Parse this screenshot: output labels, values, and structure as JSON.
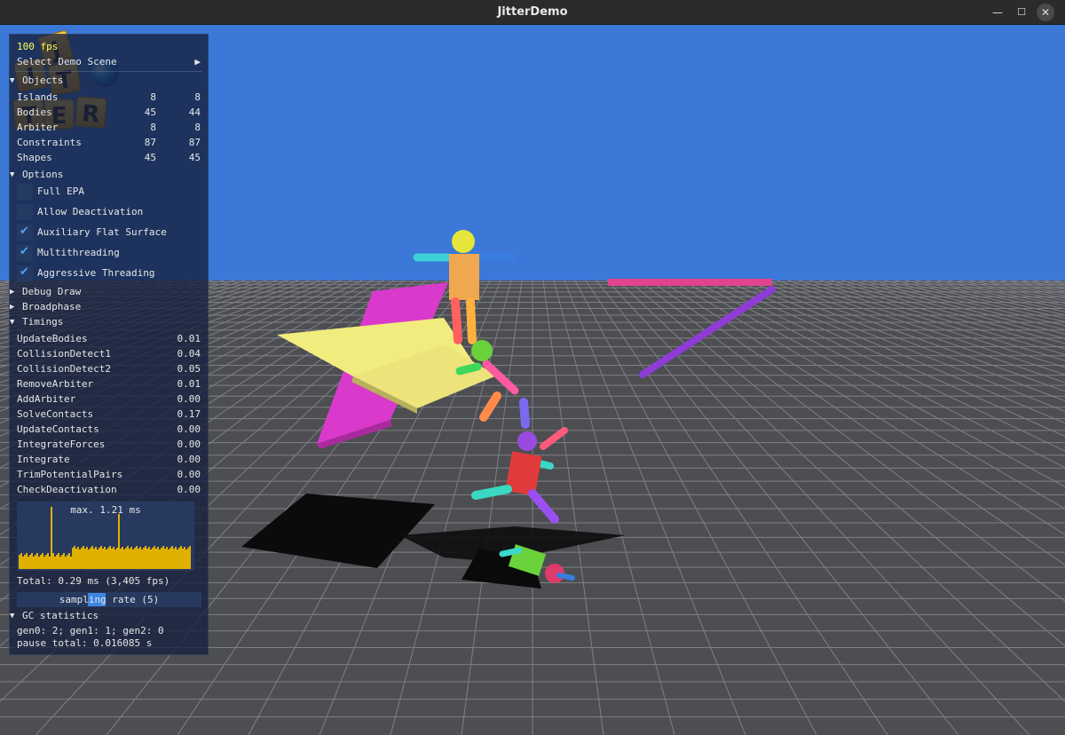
{
  "window": {
    "title": "JitterDemo",
    "minimize": "—",
    "maximize": "☐",
    "close": "✕"
  },
  "panel": {
    "fps": "100 fps",
    "select_scene": "Select Demo Scene",
    "select_arrow": "▶",
    "objects": {
      "header": "Objects",
      "rows": [
        {
          "label": "Islands",
          "a": "8",
          "b": "8"
        },
        {
          "label": "Bodies",
          "a": "45",
          "b": "44"
        },
        {
          "label": "Arbiter",
          "a": "8",
          "b": "8"
        },
        {
          "label": "Constraints",
          "a": "87",
          "b": "87"
        },
        {
          "label": "Shapes",
          "a": "45",
          "b": "45"
        }
      ]
    },
    "options": {
      "header": "Options",
      "items": [
        {
          "label": "Full EPA",
          "checked": false
        },
        {
          "label": "Allow Deactivation",
          "checked": false
        },
        {
          "label": "Auxiliary Flat Surface",
          "checked": true
        },
        {
          "label": "Multithreading",
          "checked": true
        },
        {
          "label": "Aggressive Threading",
          "checked": true
        }
      ]
    },
    "debug_draw": "Debug Draw",
    "broadphase": "Broadphase",
    "timings": {
      "header": "Timings",
      "rows": [
        {
          "label": "UpdateBodies",
          "value": "0.01"
        },
        {
          "label": "CollisionDetect1",
          "value": "0.04"
        },
        {
          "label": "CollisionDetect2",
          "value": "0.05"
        },
        {
          "label": "RemoveArbiter",
          "value": "0.01"
        },
        {
          "label": "AddArbiter",
          "value": "0.00"
        },
        {
          "label": "SolveContacts",
          "value": "0.17"
        },
        {
          "label": "UpdateContacts",
          "value": "0.00"
        },
        {
          "label": "IntegrateForces",
          "value": "0.00"
        },
        {
          "label": "Integrate",
          "value": "0.00"
        },
        {
          "label": "TrimPotentialPairs",
          "value": "0.00"
        },
        {
          "label": "CheckDeactivation",
          "value": "0.00"
        }
      ]
    },
    "graph_max": "max. 1.21 ms",
    "total": "Total: 0.29 ms (3,405 fps)",
    "sampling": "sampling rate (5)",
    "gc": {
      "header": "GC statistics",
      "gens": "gen0: 2; gen1: 1; gen2: 0",
      "pause": "pause total: 0.016085 s"
    }
  },
  "logo": {
    "letters": [
      "J",
      "I",
      "T",
      "T",
      "E",
      "R"
    ]
  },
  "colors": {
    "sky": "#3b78d8",
    "ground": "#4d4e52",
    "grid": "#8a8b90",
    "panel": "#16223e",
    "accent": "#3d85e0",
    "graph_bar": "#e0b000"
  }
}
